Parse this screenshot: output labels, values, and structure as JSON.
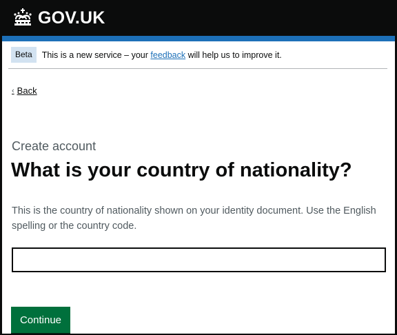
{
  "header": {
    "logo_text": "GOV.UK",
    "logo_icon": "crown-icon",
    "background_color": "#0b0c0c",
    "accent_bar_color": "#1d70b8"
  },
  "phase_banner": {
    "tag": "Beta",
    "text_before": "This is a new service – your ",
    "link_text": "feedback",
    "text_after": " will help us to improve it."
  },
  "back_link": {
    "label": "Back",
    "icon": "chevron-left-icon"
  },
  "form": {
    "caption": "Create account",
    "heading": "What is your country of nationality?",
    "hint": "This is the country of nationality shown on your identity document. Use the English spelling or the country code.",
    "input_value": "",
    "input_placeholder": "",
    "continue_label": "Continue",
    "button_color": "#00703c"
  }
}
